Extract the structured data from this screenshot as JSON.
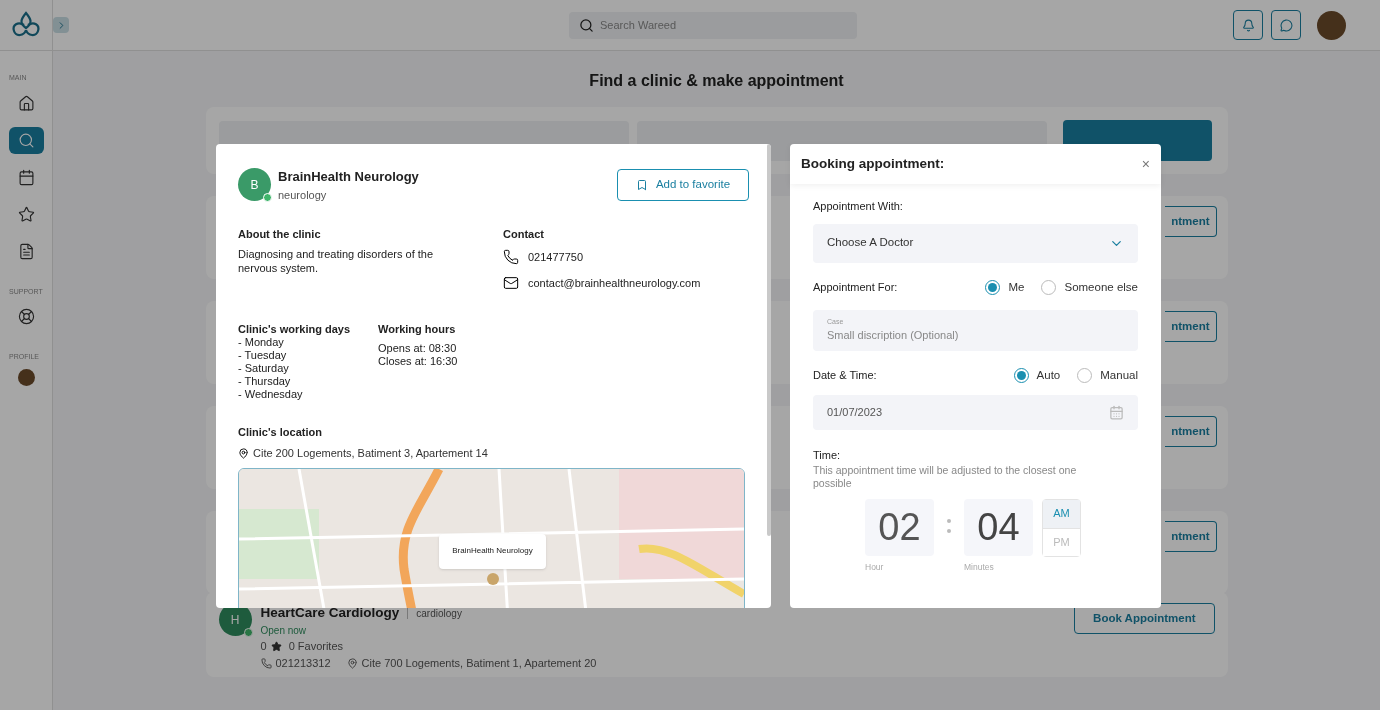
{
  "sidebar": {
    "sections": [
      {
        "label": "MAIN",
        "items": [
          {
            "kind": "home",
            "selected": false
          },
          {
            "kind": "search",
            "selected": true
          },
          {
            "kind": "calendar",
            "selected": false
          },
          {
            "kind": "star",
            "selected": false
          },
          {
            "kind": "document",
            "selected": false
          }
        ]
      },
      {
        "label": "SUPPORT",
        "items": [
          {
            "kind": "support",
            "selected": false
          }
        ]
      },
      {
        "label": "PROFILE",
        "items": [
          {
            "kind": "avatar",
            "selected": false
          }
        ]
      }
    ]
  },
  "topbar": {
    "search": {
      "placeholder": "Search Wareed"
    }
  },
  "page_title": "Find a clinic & make appointment",
  "clinic_list": [
    {
      "button": "ntment"
    },
    {
      "button": "ntment"
    },
    {
      "button": "ntment"
    },
    {
      "button": "ntment"
    }
  ],
  "visible_clinic": {
    "initial": "H",
    "online": true,
    "name": "HeartCare Cardiology",
    "category": "cardiology",
    "status": "Open now",
    "rating": "0",
    "favorites": "0 Favorites",
    "phone": "021213312",
    "address": "Cite 700 Logements, Batiment 1, Apartement 20",
    "button": "Book Appointment"
  },
  "clinic_modal": {
    "initial": "B",
    "online": true,
    "name": "BrainHealth Neurology",
    "category": "neurology",
    "favorite_button": "Add to favorite",
    "about": {
      "heading": "About the clinic",
      "text": "Diagnosing and treating disorders of the nervous system."
    },
    "contact": {
      "heading": "Contact",
      "phone": "021477750",
      "email": "contact@brainhealthneurology.com"
    },
    "working_days": {
      "heading": "Clinic's working days",
      "days": [
        "- Monday",
        "- Tuesday",
        "- Saturday",
        "- Thursday",
        "- Wednesday"
      ]
    },
    "working_hours": {
      "heading": "Working hours",
      "opens": "Opens at: 08:30",
      "closes": "Closes at: 16:30"
    },
    "location": {
      "heading": "Clinic's location",
      "address": "Cite 200 Logements, Batiment 3, Apartement 14",
      "map_popup": "BrainHealth Neurology"
    }
  },
  "booking_modal": {
    "title": "Booking appointment:",
    "close": "×",
    "appointment_with": {
      "label": "Appointment With:",
      "value": "Choose A Doctor"
    },
    "appointment_for": {
      "label": "Appointment For:",
      "options": [
        {
          "label": "Me",
          "selected": true
        },
        {
          "label": "Someone else",
          "selected": false
        }
      ]
    },
    "case": {
      "label": "Case",
      "placeholder": "Small discription (Optional)"
    },
    "date_time": {
      "label": "Date & Time:",
      "options": [
        {
          "label": "Auto",
          "selected": true
        },
        {
          "label": "Manual",
          "selected": false
        }
      ]
    },
    "date": {
      "value": "01/07/2023"
    },
    "time": {
      "label": "Time:",
      "hint": "This appointment time will be adjusted to the closest one possible",
      "hour": "02",
      "hour_label": "Hour",
      "minutes": "04",
      "minutes_label": "Minutes",
      "periods": [
        {
          "label": "AM",
          "selected": true
        },
        {
          "label": "PM",
          "selected": false
        }
      ]
    }
  }
}
